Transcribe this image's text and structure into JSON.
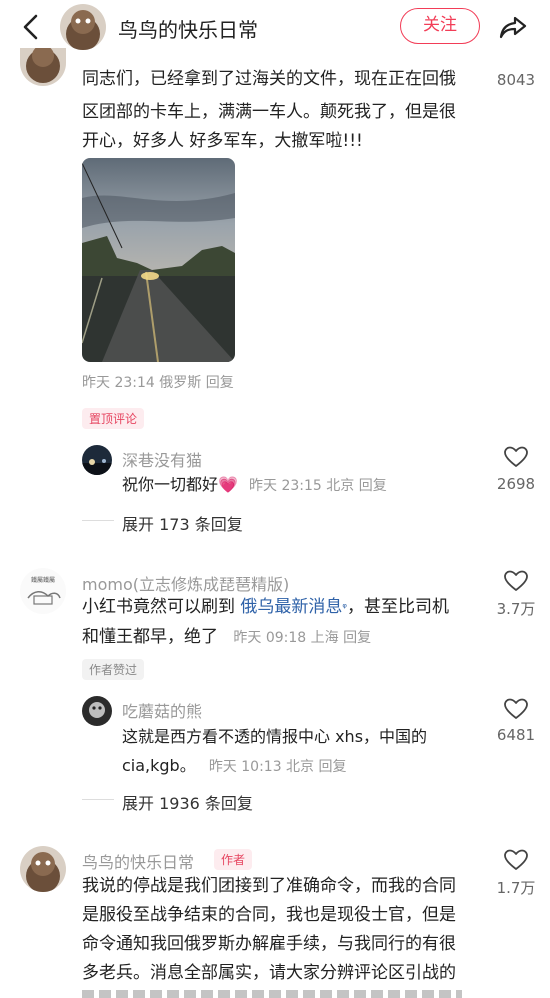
{
  "header": {
    "name": "鸟鸟的快乐日常",
    "follow_label": "关注"
  },
  "post": {
    "text_lines": [
      "同志们，已经拿到了过海关的文件，现在正在回俄",
      "区团部的卡车上，满满一车人。颠死我了，但是很",
      "开心，好多人 好多军车，大撤军啦!!!"
    ],
    "likes": "8043",
    "meta": "昨天 23:14 俄罗斯 回复",
    "pinned_tag": "置顶评论"
  },
  "reply1": {
    "name": "深巷没有猫",
    "text": "祝你一切都好",
    "emoji": "💗",
    "meta": "昨天 23:15 北京 回复",
    "likes": "2698",
    "expand": "展开 173 条回复"
  },
  "comment2": {
    "name": "momo(立志修炼成琵琶精版)",
    "line1_prefix": "小红书竟然可以刷到",
    "line1_link": "俄乌最新消息",
    "line1_suffix": "，甚至比司机",
    "line2": "和懂王都早，绝了",
    "meta": "昨天 09:18 上海 回复",
    "likes": "3.7万",
    "author_liked_tag": "作者赞过"
  },
  "reply2": {
    "name": "吃蘑菇的熊",
    "line1": "这就是西方看不透的情报中心 xhs，中国的",
    "line2": "cia,kgb。",
    "meta": "昨天 10:13 北京 回复",
    "likes": "6481",
    "expand": "展开 1936 条回复"
  },
  "comment3": {
    "name": "鸟鸟的快乐日常",
    "author_tag": "作者",
    "likes": "1.7万",
    "text_lines": [
      "我说的停战是我们团接到了准确命令，而我的合同",
      "是服役至战争结束的合同，我也是现役士官，但是",
      "命令通知我回俄罗斯办解雇手续，与我同行的有很",
      "多老兵。消息全部属实，请大家分辨评论区引战的"
    ]
  },
  "colors": {
    "accent": "#f23d57",
    "link": "#2f62a8",
    "meta": "#999999"
  },
  "icons": [
    "back-arrow-icon",
    "share-icon",
    "heart-icon"
  ]
}
